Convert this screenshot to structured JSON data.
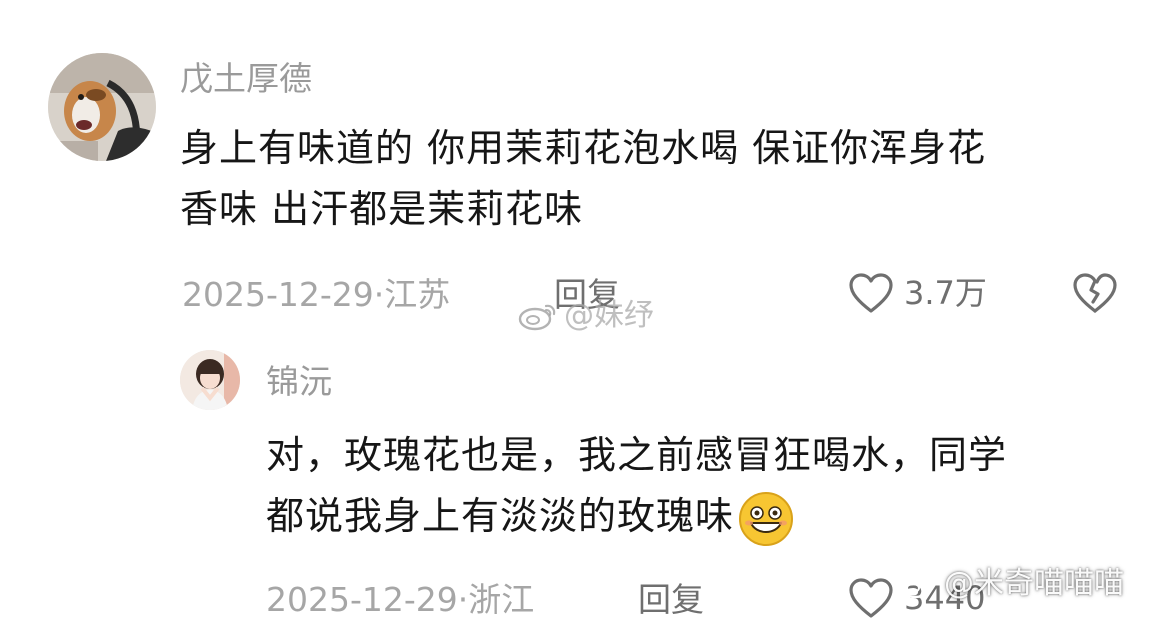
{
  "comments": [
    {
      "username": "戊土厚德",
      "text_lines": [
        "身上有味道的  你用茉莉花泡水喝  保证你浑身花",
        "香味  出汗都是茉莉花味"
      ],
      "date_location": "2025-12-29·江苏",
      "reply_label": "回复",
      "like_count": "3.7万",
      "avatar_icon": "dog-avatar-icon"
    },
    {
      "username": "锦沅",
      "text_lines": [
        "对，玫瑰花也是，我之前感冒狂喝水，同学",
        "都说我身上有淡淡的玫瑰味"
      ],
      "date_location": "2025-12-29·浙江",
      "reply_label": "回复",
      "like_count": "3440",
      "avatar_icon": "girl-avatar-icon",
      "emoji": "grinning-emoji-icon"
    }
  ],
  "watermarks": [
    {
      "text": "@妹纾",
      "icon": "weibo-logo-icon"
    },
    {
      "text": "@米奇喵喵喵",
      "icon": "weibo-logo-icon"
    }
  ],
  "colors": {
    "text": "#161616",
    "muted": "#a6a6a6",
    "reply": "#6f6f6f",
    "background": "#ffffff"
  }
}
